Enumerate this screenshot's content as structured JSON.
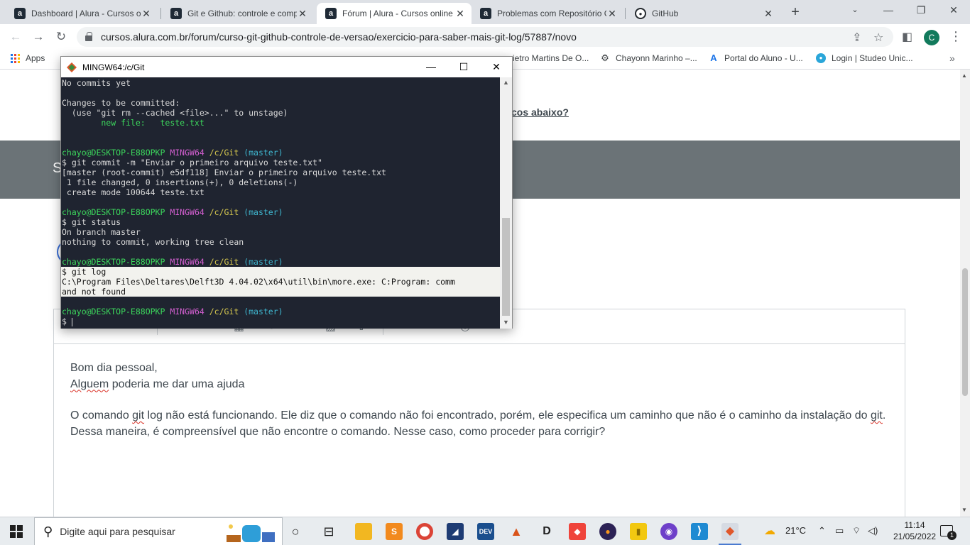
{
  "browser": {
    "tabs": [
      {
        "title": "Dashboard | Alura - Cursos o",
        "favicon": "alura-icon",
        "active": false
      },
      {
        "title": "Git e Github: controle e comp",
        "favicon": "alura-icon",
        "active": false
      },
      {
        "title": "Fórum | Alura - Cursos online",
        "favicon": "alura-icon",
        "active": true
      },
      {
        "title": "Problemas com Repositório G",
        "favicon": "alura-icon",
        "active": false
      },
      {
        "title": "GitHub",
        "favicon": "github-icon",
        "active": false
      }
    ],
    "new_tab": "+",
    "url": "cursos.alura.com.br/forum/curso-git-github-controle-de-versao/exercicio-para-saber-mais-git-log/57887/novo",
    "profile_initial": "C"
  },
  "bookmarks": [
    {
      "label": "Apps",
      "icon": "apps-grid-icon"
    },
    {
      "label": "ietro Martins De O...",
      "icon": ""
    },
    {
      "label": "Chayonn Marinho –...",
      "icon": "gear-icon"
    },
    {
      "label": "Portal do Aluno - U...",
      "icon": "portal-icon"
    },
    {
      "label": "Login | Studeo Unic...",
      "icon": "studeo-icon"
    }
  ],
  "page": {
    "link_text": "cos abaixo?",
    "band_letter": "S",
    "editor_text": {
      "line1": "Bom dia pessoal,",
      "line2_word": "Alguem",
      "line2_rest": " poderia me dar uma ajuda",
      "p2_a": "O comando ",
      "p2_git1": "git",
      "p2_b": " log não está funcionando. Ele diz que o comando não foi encontrado, porém, ele especifica um caminho que não é o caminho da instalação do ",
      "p2_git2": "git",
      "p2_c": ". Dessa maneira, é compreensível que não encontre o comando. Nesse caso, como proceder para corrigir?"
    }
  },
  "terminal": {
    "title": "MINGW64:/c/Git",
    "lines": [
      {
        "segments": [
          {
            "t": "No commits yet",
            "c": ""
          }
        ]
      },
      {
        "segments": []
      },
      {
        "segments": [
          {
            "t": "Changes to be committed:",
            "c": ""
          }
        ]
      },
      {
        "segments": [
          {
            "t": "  (use \"git rm --cached <file>...\" to unstage)",
            "c": ""
          }
        ]
      },
      {
        "segments": [
          {
            "t": "        new file:   teste.txt",
            "c": "g"
          }
        ]
      },
      {
        "segments": []
      },
      {
        "segments": []
      },
      {
        "segments": [
          {
            "t": "chayo@DESKTOP-E88OPKP ",
            "c": "g"
          },
          {
            "t": "MINGW64 ",
            "c": "m"
          },
          {
            "t": "/c/Git ",
            "c": "y"
          },
          {
            "t": "(master)",
            "c": "c"
          }
        ]
      },
      {
        "segments": [
          {
            "t": "$ git commit -m \"Enviar o primeiro arquivo teste.txt\"",
            "c": ""
          }
        ]
      },
      {
        "segments": [
          {
            "t": "[master (root-commit) e5df118] Enviar o primeiro arquivo teste.txt",
            "c": ""
          }
        ]
      },
      {
        "segments": [
          {
            "t": " 1 file changed, 0 insertions(+), 0 deletions(-)",
            "c": ""
          }
        ]
      },
      {
        "segments": [
          {
            "t": " create mode 100644 teste.txt",
            "c": ""
          }
        ]
      },
      {
        "segments": []
      },
      {
        "segments": [
          {
            "t": "chayo@DESKTOP-E88OPKP ",
            "c": "g"
          },
          {
            "t": "MINGW64 ",
            "c": "m"
          },
          {
            "t": "/c/Git ",
            "c": "y"
          },
          {
            "t": "(master)",
            "c": "c"
          }
        ]
      },
      {
        "segments": [
          {
            "t": "$ git status",
            "c": ""
          }
        ]
      },
      {
        "segments": [
          {
            "t": "On branch master",
            "c": ""
          }
        ]
      },
      {
        "segments": [
          {
            "t": "nothing to commit, working tree clean",
            "c": ""
          }
        ]
      },
      {
        "segments": []
      },
      {
        "segments": [
          {
            "t": "chayo@DESKTOP-E88OPKP ",
            "c": "g"
          },
          {
            "t": "MINGW64 ",
            "c": "m"
          },
          {
            "t": "/c/Git ",
            "c": "y"
          },
          {
            "t": "(master)",
            "c": "c"
          }
        ]
      },
      {
        "segments": [
          {
            "t": "$ git log",
            "c": ""
          }
        ],
        "highlight": true
      },
      {
        "segments": [
          {
            "t": "C:\\Program Files\\Deltares\\Delft3D 4.04.02\\x64\\util\\bin\\more.exe: C:Program: comm",
            "c": ""
          }
        ],
        "highlight": true
      },
      {
        "segments": [
          {
            "t": "and not found",
            "c": ""
          }
        ],
        "highlight": true
      },
      {
        "segments": []
      },
      {
        "segments": [
          {
            "t": "chayo@DESKTOP-E88OPKP ",
            "c": "g"
          },
          {
            "t": "MINGW64 ",
            "c": "m"
          },
          {
            "t": "/c/Git ",
            "c": "y"
          },
          {
            "t": "(master)",
            "c": "c"
          }
        ]
      },
      {
        "segments": [
          {
            "t": "$ ",
            "c": ""
          }
        ],
        "cursor": true
      }
    ]
  },
  "taskbar": {
    "search_placeholder": "Digite aqui para pesquisar",
    "apps": [
      {
        "name": "task-view-icon",
        "label": "○"
      },
      {
        "name": "task-switch-icon",
        "label": "⊟"
      },
      {
        "name": "file-explorer-icon",
        "label": ""
      },
      {
        "name": "sublime-text-icon",
        "label": "S"
      },
      {
        "name": "chrome-icon",
        "label": ""
      },
      {
        "name": "sql-server-icon",
        "label": "◢"
      },
      {
        "name": "dev-cpp-icon",
        "label": "DEV"
      },
      {
        "name": "matlab-icon",
        "label": "▲"
      },
      {
        "name": "logic-icon",
        "label": "D"
      },
      {
        "name": "anydesk-icon",
        "label": "◆"
      },
      {
        "name": "eclipse-icon",
        "label": "●"
      },
      {
        "name": "power-bi-icon",
        "label": "▮"
      },
      {
        "name": "github-desktop-icon",
        "label": "◉"
      },
      {
        "name": "vscode-icon",
        "label": "⟩"
      },
      {
        "name": "git-bash-icon",
        "label": "◆"
      }
    ],
    "weather": "21°C",
    "time": "11:14",
    "date": "21/05/2022",
    "notifications": "1"
  }
}
